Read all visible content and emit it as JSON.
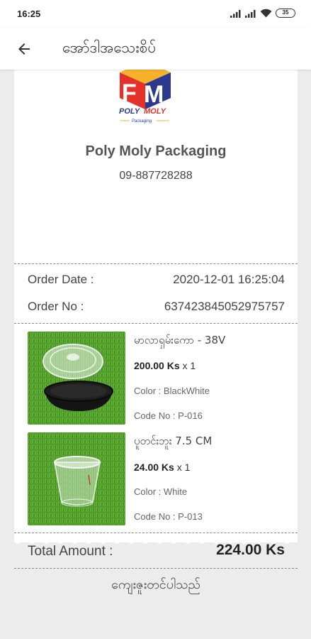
{
  "status_bar": {
    "time": "16:25",
    "battery": "35",
    "icons": [
      "signal-icon",
      "signal-icon",
      "wifi-icon",
      "battery-icon"
    ]
  },
  "app_bar": {
    "back_icon": "arrow-left-icon",
    "title": "အော်ဒါအသေးစိပ်"
  },
  "receipt": {
    "logo_letters": "FM",
    "logo_brand": "POLYMOLY",
    "logo_sub": "Packaging",
    "shop_name": "Poly Moly Packaging",
    "phone": "09-887728288",
    "order_date_label": "Order Date :",
    "order_date": "2020-12-01 16:25:04",
    "order_no_label": "Order No :",
    "order_no": "637423845052975757",
    "items": [
      {
        "name": "မာလာရှမ်းကော - 38V",
        "price": "200.00 Ks",
        "qty": " x 1",
        "color": "Color : BlackWhite",
        "code": "Code No : P-016"
      },
      {
        "name": "ပူတင်းဘူး 7.5 CM",
        "price": "24.00 Ks",
        "qty": " x 1",
        "color": "Color : White",
        "code": "Code No : P-013"
      }
    ],
    "total_label": "Total Amount :",
    "total_value": "224.00 Ks",
    "thanks": "ကျေးဇူးတင်ပါသည်"
  },
  "colors": {
    "background": "#ececec",
    "logo_orange": "#f5a623",
    "logo_red": "#e4322b",
    "logo_blue": "#2b3a8f",
    "grass": "#4f9a2c"
  }
}
